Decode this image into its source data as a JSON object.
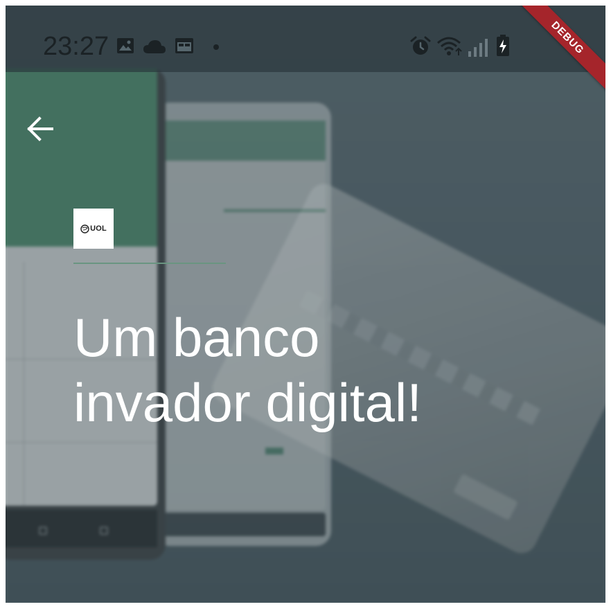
{
  "status_bar": {
    "time": "23:27",
    "left_icons": [
      "gallery-icon",
      "cloud-icon",
      "calendar-icon",
      "notification-dot"
    ],
    "right_icons": [
      "alarm-icon",
      "wifi-icon",
      "signal-icon",
      "battery-charging-icon"
    ]
  },
  "debug_banner": {
    "label": "DEBUG",
    "color": "#a5252b"
  },
  "navigation": {
    "back_icon": "arrow-left-icon"
  },
  "brand": {
    "logo_text": "UOL",
    "accent_color": "#6a9581"
  },
  "hero": {
    "line1": "Um banco",
    "line2": "invador digital!"
  }
}
